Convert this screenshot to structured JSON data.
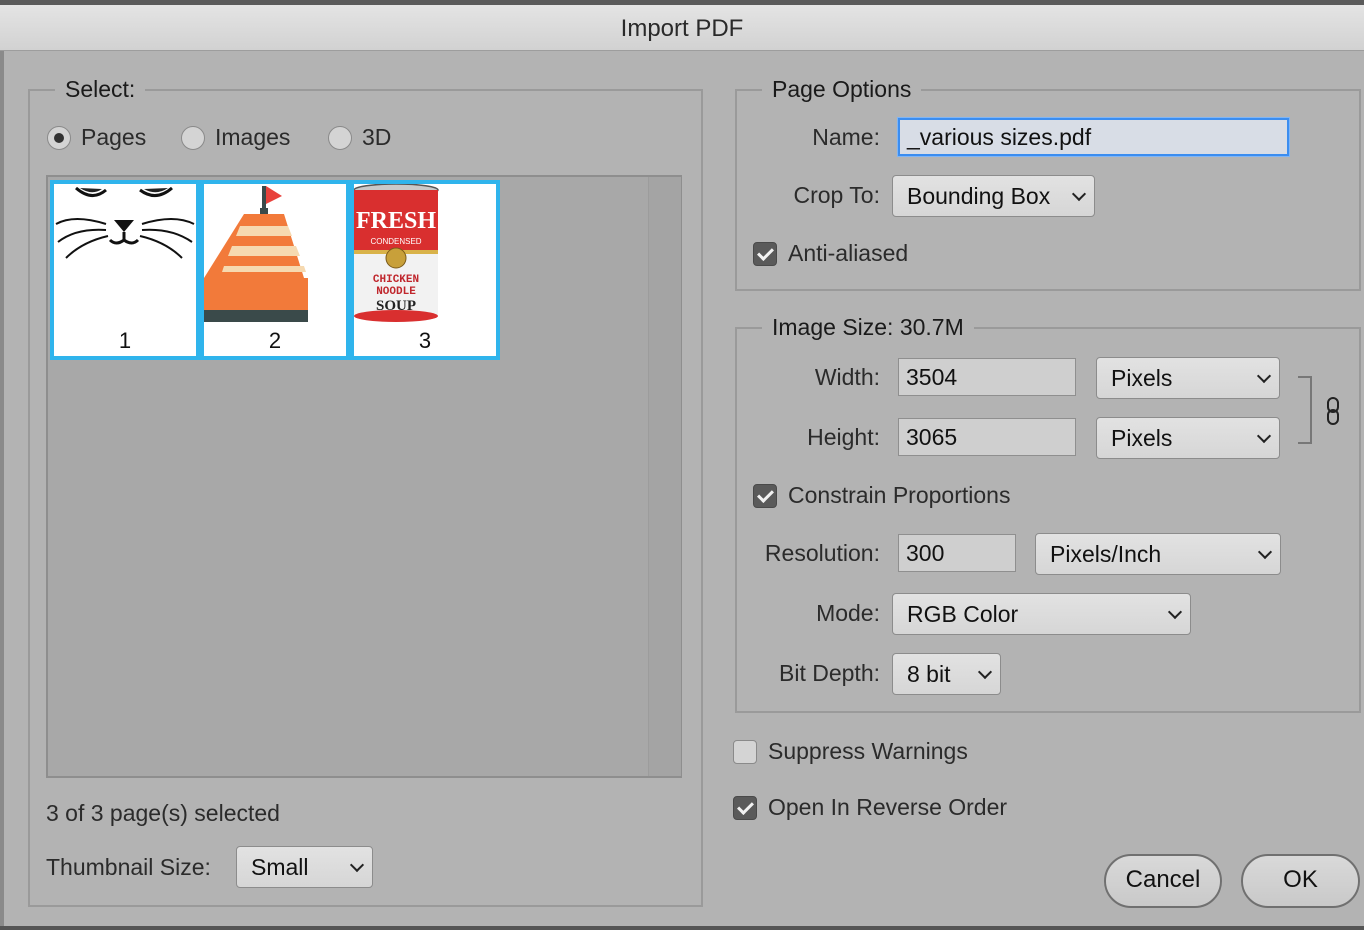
{
  "window": {
    "title": "Import PDF"
  },
  "select_group": {
    "legend": "Select:",
    "options": [
      {
        "label": "Pages",
        "selected": true
      },
      {
        "label": "Images",
        "selected": false
      },
      {
        "label": "3D",
        "selected": false
      }
    ],
    "thumbnails": [
      {
        "number": "1",
        "icon": "cat-face-icon"
      },
      {
        "number": "2",
        "icon": "buoy-icon"
      },
      {
        "number": "3",
        "icon": "soup-can-icon",
        "can_text": {
          "brand": "FRESH",
          "sub": "CONDENSED",
          "line1": "CHICKEN",
          "line2": "NOODLE",
          "line3": "SOUP"
        }
      }
    ],
    "selection_status": "3 of 3 page(s) selected",
    "thumbnail_size": {
      "label": "Thumbnail Size:",
      "value": "Small"
    }
  },
  "page_options": {
    "legend": "Page Options",
    "name": {
      "label": "Name:",
      "value": "_various sizes.pdf"
    },
    "crop_to": {
      "label": "Crop To:",
      "value": "Bounding Box"
    },
    "anti_aliased": {
      "label": "Anti-aliased",
      "checked": true
    }
  },
  "image_size": {
    "legend": "Image Size: 30.7M",
    "width": {
      "label": "Width:",
      "value": "3504",
      "unit": "Pixels"
    },
    "height": {
      "label": "Height:",
      "value": "3065",
      "unit": "Pixels"
    },
    "link_icon": "chain-link-icon",
    "constrain": {
      "label": "Constrain Proportions",
      "checked": true
    },
    "resolution": {
      "label": "Resolution:",
      "value": "300",
      "unit": "Pixels/Inch"
    },
    "mode": {
      "label": "Mode:",
      "value": "RGB Color"
    },
    "bit_depth": {
      "label": "Bit Depth:",
      "value": "8 bit"
    }
  },
  "suppress_warnings": {
    "label": "Suppress Warnings",
    "checked": false
  },
  "open_reverse": {
    "label": "Open In Reverse Order",
    "checked": true
  },
  "buttons": {
    "cancel": "Cancel",
    "ok": "OK"
  },
  "colors": {
    "selection_border": "#2fb4ec",
    "focus_ring": "#3b8df0",
    "dialog_bg": "#b3b3b3"
  }
}
